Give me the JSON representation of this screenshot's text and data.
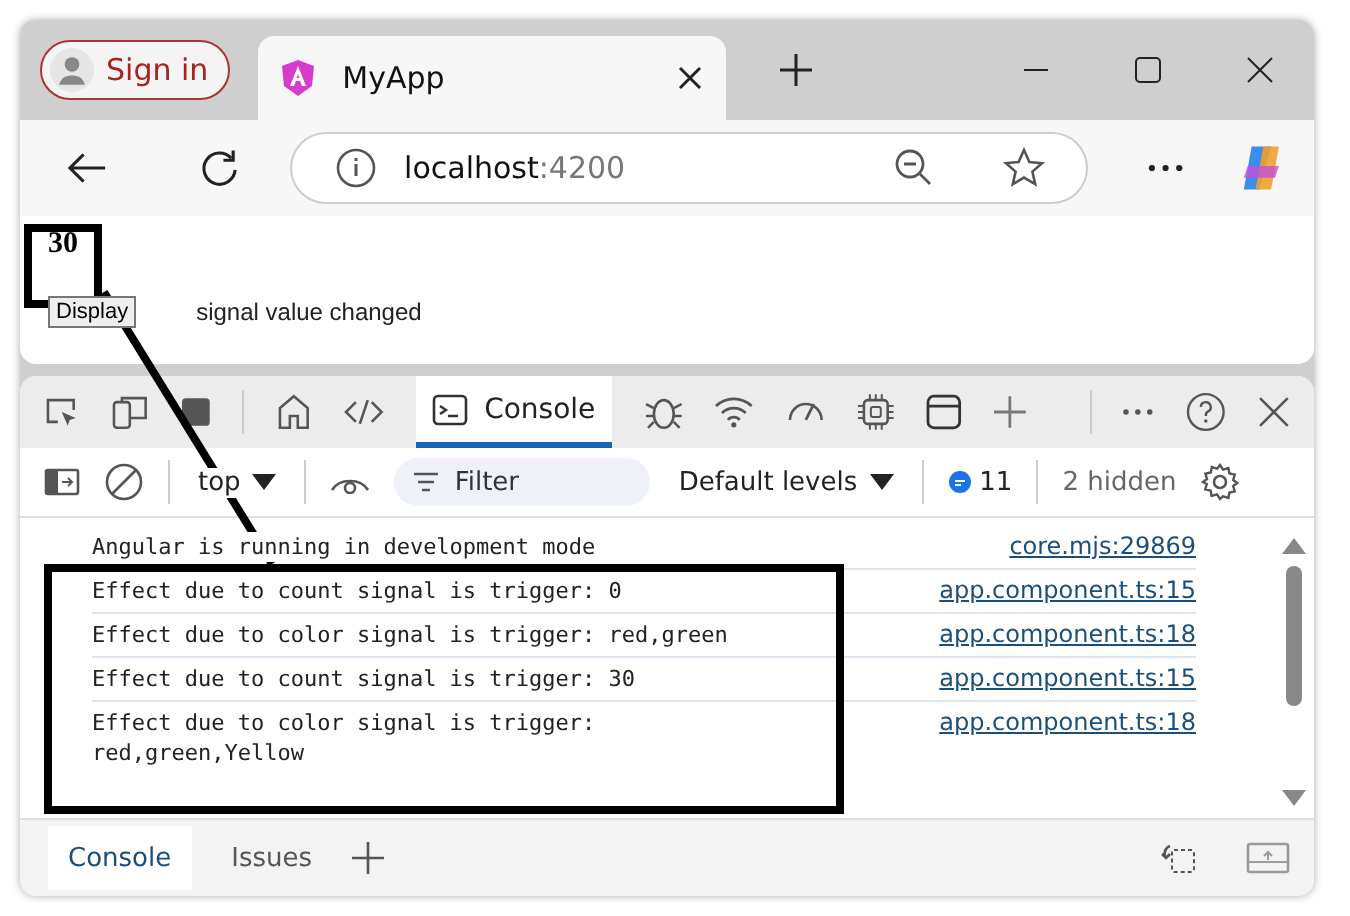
{
  "browser": {
    "profile_button": "Sign in",
    "tab": {
      "title": "MyApp"
    },
    "address": {
      "host": "localhost",
      "port": ":4200"
    }
  },
  "page": {
    "value": "30",
    "button": "Display",
    "message": "signal value changed"
  },
  "devtools": {
    "panel_tab": {
      "label": "Console",
      "selected": true
    },
    "console_toolbar": {
      "context": "top",
      "filter_placeholder": "Filter",
      "levels": "Default levels",
      "message_count": "11",
      "hidden": "2 hidden"
    },
    "logs": [
      {
        "text": "Angular is running in development mode",
        "source": "core.mjs:29869"
      },
      {
        "text": "Effect due to count signal is trigger: 0",
        "source": "app.component.ts:15"
      },
      {
        "text": "Effect due to color signal is trigger: red,green",
        "source": "app.component.ts:18"
      },
      {
        "text": "Effect due to count signal is trigger: 30",
        "source": "app.component.ts:15"
      },
      {
        "text": "Effect due to color signal is trigger:\nred,green,Yellow",
        "source": "app.component.ts:18"
      }
    ],
    "drawer_tabs": [
      {
        "label": "Console",
        "selected": true
      },
      {
        "label": "Issues",
        "selected": false
      }
    ]
  }
}
